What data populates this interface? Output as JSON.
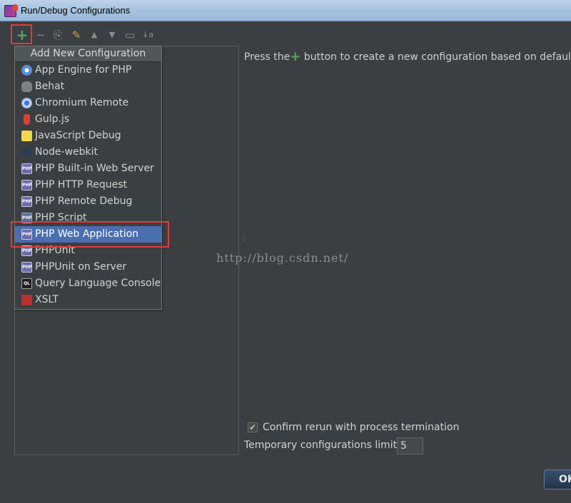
{
  "window": {
    "title": "Run/Debug Configurations"
  },
  "toolbar": {
    "add": "+",
    "remove": "−",
    "copy": "⎘",
    "edit_defaults": "✎",
    "move_up": "▲",
    "move_down": "▼",
    "folder": "▭",
    "sort": "↓a"
  },
  "popup": {
    "header": "Add New Configuration",
    "items": [
      {
        "label": "App Engine for PHP",
        "icon": "app-engine-icon"
      },
      {
        "label": "Behat",
        "icon": "behat-icon"
      },
      {
        "label": "Chromium Remote",
        "icon": "chromium-icon"
      },
      {
        "label": "Gulp.js",
        "icon": "gulp-icon"
      },
      {
        "label": "JavaScript Debug",
        "icon": "javascript-debug-icon"
      },
      {
        "label": "Node-webkit",
        "icon": "node-webkit-icon"
      },
      {
        "label": "PHP Built-in Web Server",
        "icon": "php-icon",
        "icon_text": "PHP"
      },
      {
        "label": "PHP HTTP Request",
        "icon": "php-icon",
        "icon_text": "PHP"
      },
      {
        "label": "PHP Remote Debug",
        "icon": "php-icon",
        "icon_text": "PHP"
      },
      {
        "label": "PHP Script",
        "icon": "php-script-icon",
        "icon_text": "PHP"
      },
      {
        "label": "PHP Web Application",
        "icon": "php-icon",
        "icon_text": "PHP",
        "selected": true
      },
      {
        "label": "PHPUnit",
        "icon": "php-icon",
        "icon_text": "PHP"
      },
      {
        "label": "PHPUnit on Server",
        "icon": "php-icon",
        "icon_text": "PHP"
      },
      {
        "label": "Query Language Console",
        "icon": "query-console-icon",
        "icon_text": "QL"
      },
      {
        "label": "XSLT",
        "icon": "xslt-icon"
      }
    ]
  },
  "main": {
    "hint_prefix": "Press the",
    "hint_plus": "+",
    "hint_suffix": " button to create a new configuration based on default s",
    "watermark": "http://blog.csdn.net/",
    "confirm_label": "Confirm rerun with process termination",
    "confirm_checked": true,
    "limit_label": "Temporary configurations limit:",
    "limit_value": "5",
    "ok_label": "OK"
  },
  "colors": {
    "background": "#3c3f41",
    "selection": "#4b6eaf",
    "add_green": "#59a869",
    "annotation_red": "#e03a3a"
  }
}
